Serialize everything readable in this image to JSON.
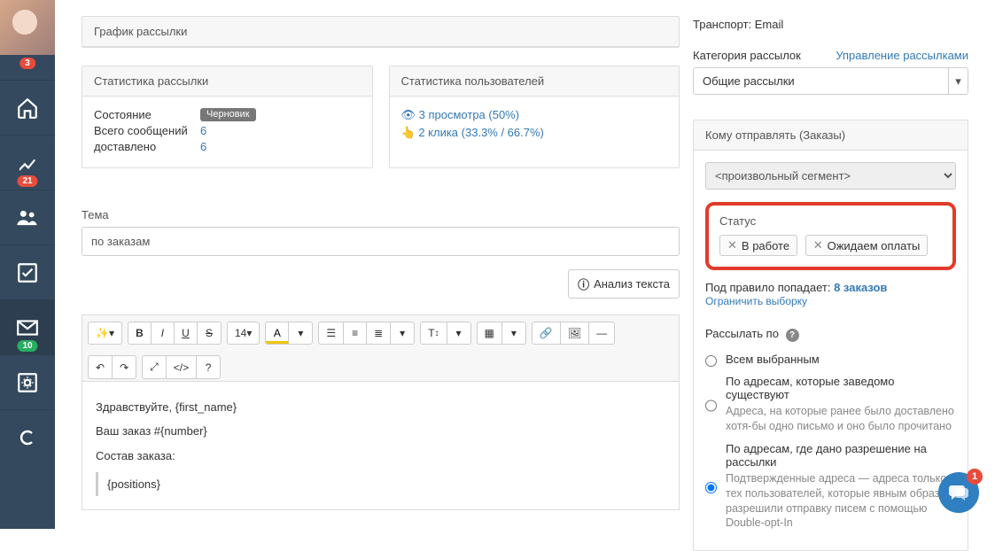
{
  "sidebar": {
    "notification_badge": "3",
    "reports_badge": "21",
    "mail_badge": "10"
  },
  "schedule": {
    "title": "График рассылки"
  },
  "stats": {
    "title": "Статистика рассылки",
    "state_label": "Состояние",
    "state_value": "Черновик",
    "total_label": "Всего сообщений",
    "total_value": "6",
    "delivered_label": "доставлено",
    "delivered_value": "6"
  },
  "userstats": {
    "title": "Статистика пользователей",
    "views": "3 просмотра (50%)",
    "clicks": "2 клика (33.3% / 66.7%)"
  },
  "subject": {
    "label": "Тема",
    "value": "по заказам"
  },
  "analyze_btn": "Анализ текста",
  "editor": {
    "greet": "Здравствуйте, {first_name}",
    "order": "Ваш заказ #{number}",
    "contents_label": "Состав заказа:",
    "positions": "{positions}",
    "h_size": "14"
  },
  "transport": {
    "label": "Транспорт:",
    "value": "Email"
  },
  "category": {
    "label": "Категория рассылок",
    "manage_link": "Управление рассылками",
    "value": "Общие рассылки"
  },
  "recipients": {
    "title": "Кому отправлять (Заказы)",
    "segment_placeholder": "<произвольный сегмент>",
    "status_label": "Статус",
    "tags": [
      "В работе",
      "Ожидаем оплаты"
    ],
    "match_prefix": "Под правило попадает:",
    "match_count": "8 заказов",
    "limit_link": "Ограничить выборку",
    "send_by_label": "Рассылать по",
    "radios": {
      "all": {
        "label": "Всем выбранным"
      },
      "existing": {
        "label": "По адресам, которые заведомо существуют",
        "desc": "Адреса, на которые ранее было доставлено хотя-бы одно письмо и оно было прочитано"
      },
      "optin": {
        "label": "По адресам, где дано разрешение на рассылки",
        "desc": "Подтвержденные адреса — адреса только тех пользователей, которые явным образом разрешили отправку писем с помощью Double-opt-In"
      }
    }
  },
  "fab_badge": "1"
}
